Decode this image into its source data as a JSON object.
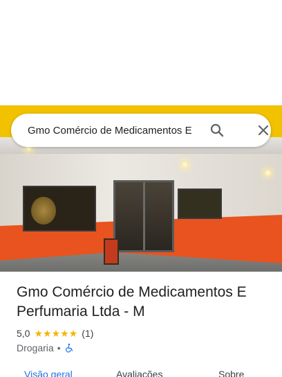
{
  "search": {
    "query": "Gmo Comércio de Medicamentos E"
  },
  "place": {
    "title": "Gmo Comércio de Medicamentos E Perfumaria Ltda - M",
    "rating": "5,0",
    "stars": 5,
    "review_count": "(1)",
    "category": "Drogaria",
    "separator": "•"
  },
  "tabs": [
    {
      "label": "Visão geral",
      "active": true
    },
    {
      "label": "Avaliações",
      "active": false
    },
    {
      "label": "Sobre",
      "active": false
    }
  ],
  "icons": {
    "search": "search-icon",
    "close": "close-icon",
    "star": "star-icon",
    "accessibility": "wheelchair-icon"
  },
  "colors": {
    "accent": "#1a73e8",
    "star": "#f4b400",
    "text_primary": "#202124",
    "text_secondary": "#5f6368"
  }
}
